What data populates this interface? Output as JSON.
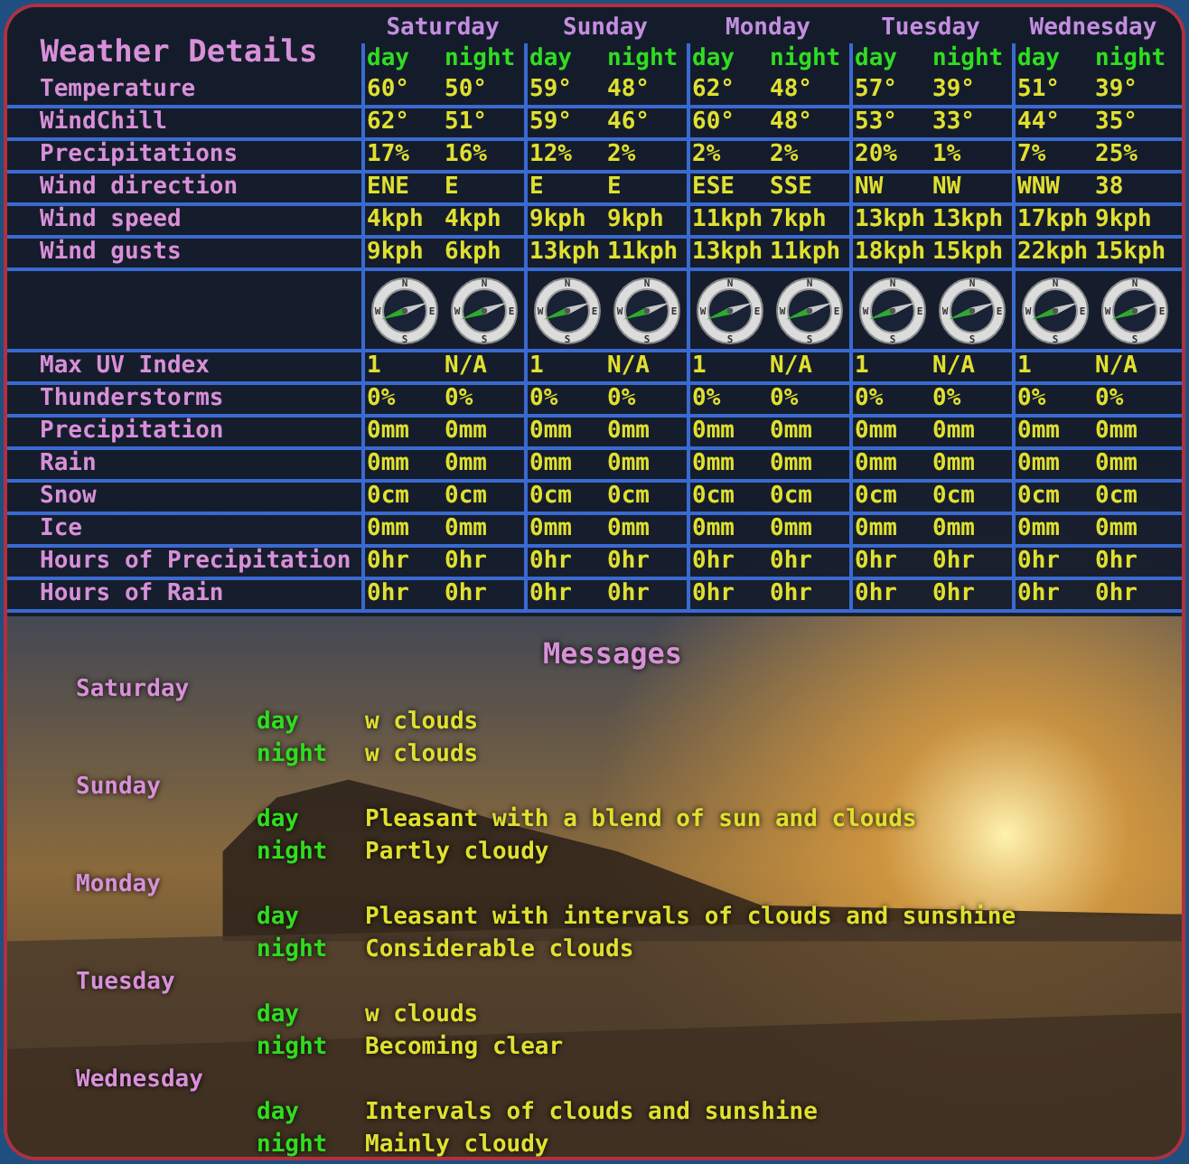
{
  "title": "Weather Details",
  "days": [
    {
      "name": "Saturday",
      "parts": [
        "day",
        "night"
      ]
    },
    {
      "name": "Sunday",
      "parts": [
        "day",
        "night"
      ]
    },
    {
      "name": "Monday",
      "parts": [
        "day",
        "night"
      ]
    },
    {
      "name": "Tuesday",
      "parts": [
        "day",
        "night"
      ]
    },
    {
      "name": "Wednesday",
      "parts": [
        "day",
        "night"
      ]
    }
  ],
  "rows": [
    {
      "kind": "text",
      "label": "Temperature",
      "values": [
        "60°",
        "50°",
        "59°",
        "48°",
        "62°",
        "48°",
        "57°",
        "39°",
        "51°",
        "39°"
      ]
    },
    {
      "kind": "text",
      "label": "WindChill",
      "values": [
        "62°",
        "51°",
        "59°",
        "46°",
        "60°",
        "48°",
        "53°",
        "33°",
        "44°",
        "35°"
      ]
    },
    {
      "kind": "text",
      "label": "Precipitations",
      "values": [
        "17%",
        "16%",
        "12%",
        "2%",
        "2%",
        "2%",
        "20%",
        "1%",
        "7%",
        "25%"
      ]
    },
    {
      "kind": "text",
      "label": "Wind direction",
      "values": [
        "ENE",
        "E",
        "E",
        "E",
        "ESE",
        "SSE",
        "NW",
        "NW",
        "WNW",
        "38"
      ]
    },
    {
      "kind": "text",
      "label": "Wind speed",
      "values": [
        "4kph",
        "4kph",
        "9kph",
        "9kph",
        "11kph",
        "7kph",
        "13kph",
        "13kph",
        "17kph",
        "9kph"
      ]
    },
    {
      "kind": "text",
      "label": "Wind gusts",
      "values": [
        "9kph",
        "6kph",
        "13kph",
        "11kph",
        "13kph",
        "11kph",
        "18kph",
        "15kph",
        "22kph",
        "15kph"
      ]
    },
    {
      "kind": "compass",
      "compasses": [
        {
          "marks": [
            "N",
            "E",
            "S",
            "W"
          ]
        },
        {
          "marks": [
            "N",
            "E",
            "S",
            "W"
          ]
        },
        {
          "marks": [
            "N",
            "E",
            "S",
            "W"
          ]
        },
        {
          "marks": [
            "N",
            "E",
            "S",
            "W"
          ]
        },
        {
          "marks": [
            "N",
            "E",
            "S",
            "W"
          ]
        },
        {
          "marks": [
            "N",
            "E",
            "S",
            "W"
          ]
        },
        {
          "marks": [
            "N",
            "E",
            "S",
            "W"
          ]
        },
        {
          "marks": [
            "N",
            "E",
            "S",
            "W"
          ]
        },
        {
          "marks": [
            "N",
            "E",
            "S",
            "W"
          ]
        },
        {
          "marks": [
            "N",
            "E",
            "S",
            "W"
          ]
        }
      ]
    },
    {
      "kind": "text",
      "label": "Max UV Index",
      "values": [
        "1",
        "N/A",
        "1",
        "N/A",
        "1",
        "N/A",
        "1",
        "N/A",
        "1",
        "N/A"
      ]
    },
    {
      "kind": "text",
      "label": "Thunderstorms",
      "values": [
        "0%",
        "0%",
        "0%",
        "0%",
        "0%",
        "0%",
        "0%",
        "0%",
        "0%",
        "0%"
      ]
    },
    {
      "kind": "text",
      "label": "Precipitation",
      "values": [
        "0mm",
        "0mm",
        "0mm",
        "0mm",
        "0mm",
        "0mm",
        "0mm",
        "0mm",
        "0mm",
        "0mm"
      ]
    },
    {
      "kind": "text",
      "label": "Rain",
      "values": [
        "0mm",
        "0mm",
        "0mm",
        "0mm",
        "0mm",
        "0mm",
        "0mm",
        "0mm",
        "0mm",
        "0mm"
      ]
    },
    {
      "kind": "text",
      "label": "Snow",
      "values": [
        "0cm",
        "0cm",
        "0cm",
        "0cm",
        "0cm",
        "0cm",
        "0cm",
        "0cm",
        "0cm",
        "0cm"
      ]
    },
    {
      "kind": "text",
      "label": "Ice",
      "values": [
        "0mm",
        "0mm",
        "0mm",
        "0mm",
        "0mm",
        "0mm",
        "0mm",
        "0mm",
        "0mm",
        "0mm"
      ]
    },
    {
      "kind": "text",
      "label": "Hours of Precipitation",
      "values": [
        "0hr",
        "0hr",
        "0hr",
        "0hr",
        "0hr",
        "0hr",
        "0hr",
        "0hr",
        "0hr",
        "0hr"
      ]
    },
    {
      "kind": "text",
      "label": "Hours of Rain",
      "values": [
        "0hr",
        "0hr",
        "0hr",
        "0hr",
        "0hr",
        "0hr",
        "0hr",
        "0hr",
        "0hr",
        "0hr"
      ]
    }
  ],
  "messages": {
    "title": "Messages",
    "days": [
      {
        "name": "Saturday",
        "entries": [
          {
            "part": "day",
            "text": "w clouds"
          },
          {
            "part": "night",
            "text": "w clouds"
          }
        ]
      },
      {
        "name": "Sunday",
        "entries": [
          {
            "part": "day",
            "text": "Pleasant with a blend of sun and clouds"
          },
          {
            "part": "night",
            "text": "Partly cloudy"
          }
        ]
      },
      {
        "name": "Monday",
        "entries": [
          {
            "part": "day",
            "text": "Pleasant with intervals of clouds and sunshine"
          },
          {
            "part": "night",
            "text": "Considerable clouds"
          }
        ]
      },
      {
        "name": "Tuesday",
        "entries": [
          {
            "part": "day",
            "text": "w clouds"
          },
          {
            "part": "night",
            "text": "Becoming clear"
          }
        ]
      },
      {
        "name": "Wednesday",
        "entries": [
          {
            "part": "day",
            "text": "Intervals of clouds and sunshine"
          },
          {
            "part": "night",
            "text": "Mainly cloudy"
          }
        ]
      }
    ]
  }
}
